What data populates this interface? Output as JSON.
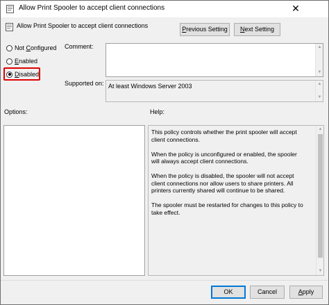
{
  "window": {
    "title": "Allow Print Spooler to accept client connections",
    "close_glyph": "✕"
  },
  "header": {
    "policy_name": "Allow Print Spooler to accept client connections",
    "previous_setting_button": {
      "accel": "P",
      "rest": "revious Setting"
    },
    "next_setting_button": {
      "accel": "N",
      "rest": "ext Setting"
    }
  },
  "state_options": {
    "not_configured": {
      "pre": "Not ",
      "accel": "C",
      "post": "onfigured",
      "checked": false
    },
    "enabled": {
      "pre": "",
      "accel": "E",
      "post": "nabled",
      "checked": false
    },
    "disabled": {
      "pre": "",
      "accel": "D",
      "post": "isabled",
      "checked": true
    }
  },
  "labels": {
    "comment": "Comment:",
    "supported_on": "Supported on:",
    "options": "Options:",
    "help": "Help:"
  },
  "supported_on_value": "At least Windows Server 2003",
  "help": {
    "paragraphs": [
      "This policy controls whether the print spooler will accept client connections.",
      "When the policy is unconfigured or enabled, the spooler will always accept client connections.",
      "When the policy is disabled, the spooler will not accept client connections nor allow users to share printers.  All printers currently shared will continue to be shared.",
      "The spooler must be restarted for changes to this policy to take effect."
    ]
  },
  "footer": {
    "ok_label": "OK",
    "cancel_label": "Cancel",
    "apply_accel": "A",
    "apply_rest": "pply"
  },
  "colors": {
    "highlight_border": "#e00000",
    "default_button_border": "#0078d7",
    "dialog_background": "#f0f0f0"
  },
  "icons": {
    "title_icon": "policy-setting-icon",
    "header_icon": "policy-setting-icon",
    "close": "close-icon",
    "scroll_up": "scroll-up-arrow-icon",
    "scroll_down": "scroll-down-arrow-icon"
  }
}
